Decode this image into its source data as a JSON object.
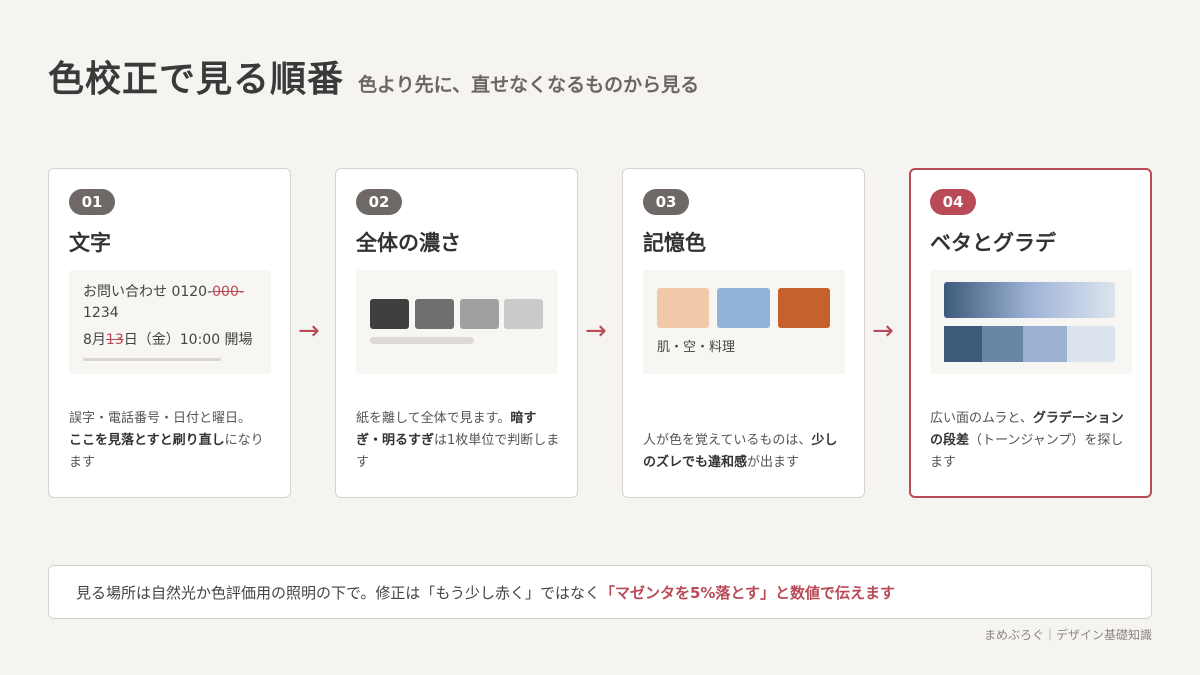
{
  "header": {
    "title": "色校正で見る順番",
    "subtitle": "色より先に、直せなくなるものから見る"
  },
  "steps": [
    {
      "number": "01",
      "title": "文字",
      "sample": {
        "line1_prefix": "お問い合わせ 0120-",
        "line1_struck": "000-",
        "line1_cont": "1234",
        "line2_prefix": "8月",
        "line2_struck": "13",
        "line2_suffix": "日（金）10:00 開場"
      },
      "desc": {
        "p1": "誤字・電話番号・日付と曜日。",
        "b1": "ここを見落とすと刷り直し",
        "p2": "になります"
      }
    },
    {
      "number": "02",
      "title": "全体の濃さ",
      "swatches": [
        "#3f3f3f",
        "#6f6f6f",
        "#a0a0a0",
        "#cacaca"
      ],
      "desc": {
        "p1": "紙を離して全体で見ます。",
        "b1": "暗すぎ・明るすぎ",
        "p2": "は1枚単位で判断します"
      }
    },
    {
      "number": "03",
      "title": "記憶色",
      "swatches": [
        "#f1c9aa",
        "#8fb3d9",
        "#c6602c"
      ],
      "sample_label": "肌・空・料理",
      "desc": {
        "p1": "人が色を覚えているものは、",
        "b1": "少しのズレでも違和感",
        "p2": "が出ます"
      }
    },
    {
      "number": "04",
      "title": "ベタとグラデ",
      "bands": [
        "#3d5a7a",
        "#6a86a6",
        "#9bb2d3",
        "#dbe3ee"
      ],
      "desc": {
        "p1": "広い面のムラと、",
        "b1": "グラデーションの段差",
        "p2": "（トーンジャンプ）を探します"
      }
    }
  ],
  "arrow_glyph": "→",
  "note": {
    "text": "見る場所は自然光か色評価用の照明の下で。修正は「もう少し赤く」ではなく",
    "emphasis": "「マゼンタを5%落とす」と数値で伝えます"
  },
  "credit": "まめぶろぐ｜デザイン基礎知識",
  "colors": {
    "accent": "#b94a57",
    "badge": "#6e6866",
    "background": "#f5f4f1"
  }
}
